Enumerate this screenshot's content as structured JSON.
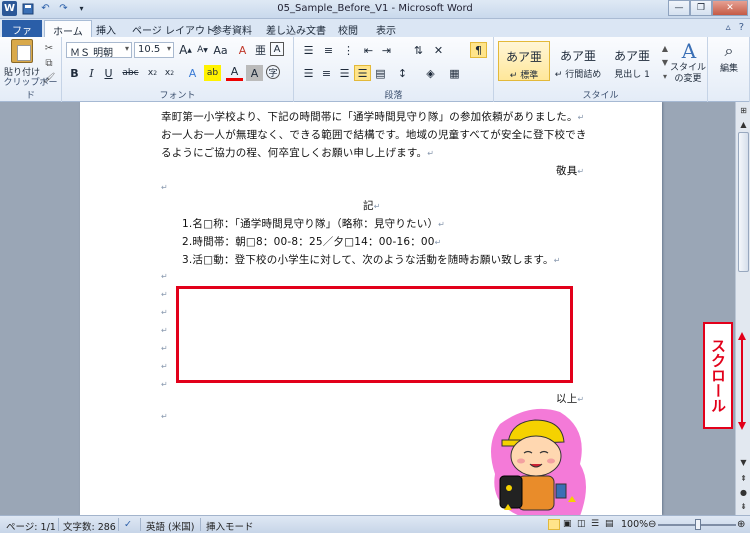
{
  "window": {
    "title": "05_Sample_Before_V1 - Microsoft Word"
  },
  "tabs": [
    {
      "label": "ファイル"
    },
    {
      "label": "ホーム"
    },
    {
      "label": "挿入"
    },
    {
      "label": "ページ レイアウト"
    },
    {
      "label": "参考資料"
    },
    {
      "label": "差し込み文書"
    },
    {
      "label": "校閲"
    },
    {
      "label": "表示"
    }
  ],
  "ribbon": {
    "clipboard": {
      "paste_label": "貼り付け",
      "group_label": "クリップボード"
    },
    "font": {
      "font_name": "ＭＳ 明朝",
      "font_size": "10.5",
      "group_label": "フォント"
    },
    "paragraph": {
      "group_label": "段落"
    },
    "styles": {
      "group_label": "スタイル",
      "items": [
        {
          "preview": "あア亜",
          "name": "↵ 標準"
        },
        {
          "preview": "あア亜",
          "name": "↵ 行間詰め"
        },
        {
          "preview": "あア亜",
          "name": "見出し 1"
        }
      ],
      "change_label": "スタイルの変更"
    },
    "editing": {
      "label": "編集"
    }
  },
  "document": {
    "lines": [
      "幸町第一小学校より、下記の時間帯に「通学時間見守り隊」の参加依頼がありました。",
      "お一人お一人が無理なく、できる範囲で結構です。地域の児童すべてが安全に登下校でき",
      "るようにご協力の程、何卒宜しくお願い申し上げます。",
      "敬具",
      "記",
      "1.名□称：「通学時間見守り隊」（略称：見守りたい）",
      "2.時間帯：朝□8：00-8：25／夕□14：00-16：00",
      "3.活□動：登下校の小学生に対して、次のような活動を随時お願い致します。",
      "以上"
    ],
    "para_mark": "↵"
  },
  "callout": {
    "text": "スクロール"
  },
  "statusbar": {
    "page": "ページ: 1/1",
    "words": "文字数: 286",
    "language": "英語 (米国)",
    "mode": "挿入モード",
    "zoom": "100%"
  }
}
